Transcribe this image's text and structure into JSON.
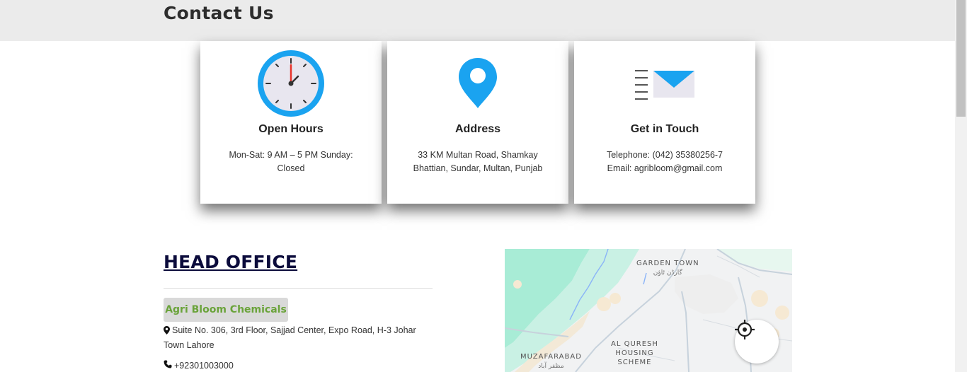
{
  "header": {
    "title": "Contact Us"
  },
  "cards": [
    {
      "title": "Open Hours",
      "text": "Mon-Sat: 9 AM – 5 PM Sunday: Closed",
      "icon": "clock-icon"
    },
    {
      "title": "Address",
      "text": "33 KM Multan Road, Shamkay Bhattian, Sundar, Multan, Punjab",
      "icon": "map-pin-icon"
    },
    {
      "title": "Get in Touch",
      "line1": "Telephone: (042) 35380256-7",
      "line2": "Email: agribloom@gmail.com",
      "icon": "envelope-icon"
    }
  ],
  "office": {
    "heading": "HEAD OFFICE",
    "company": "Agri Bloom Chemicals",
    "address": "Suite No. 306, 3rd Floor, Sajjad Center, Expo Road, H-3 Johar Town Lahore",
    "phone": "+92301003000"
  },
  "map": {
    "labels": {
      "garden_town": "GARDEN TOWN",
      "garden_town_urdu": "گارڈن ٹاؤن",
      "al_quresh": "AL QURESH",
      "housing": "HOUSING",
      "scheme": "SCHEME",
      "muzafarabad": "MUZAFARABAD",
      "muzafarabad_urdu": "مظفر آباد"
    }
  },
  "colors": {
    "accent_blue": "#1aa3f0",
    "company_green": "#6aa33a",
    "heading_navy": "#0b0b3b"
  }
}
